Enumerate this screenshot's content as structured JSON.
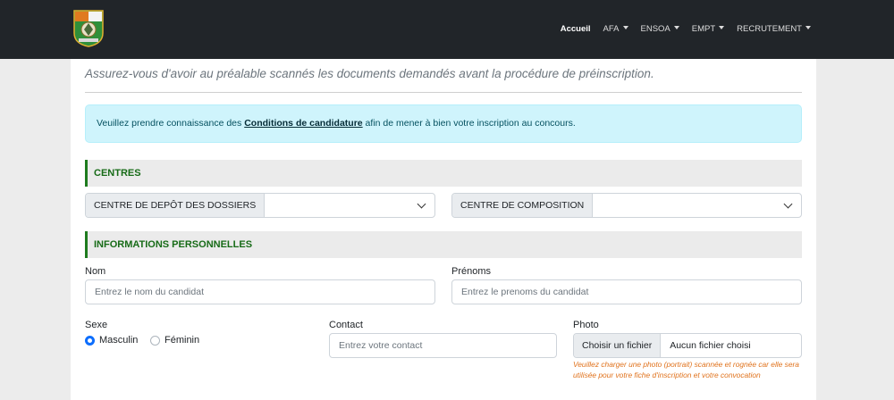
{
  "nav": {
    "logo": "crest-logo",
    "items": [
      {
        "label": "Accueil",
        "dropdown": false,
        "active": true
      },
      {
        "label": "AFA",
        "dropdown": true,
        "active": false
      },
      {
        "label": "ENSOA",
        "dropdown": true,
        "active": false
      },
      {
        "label": "EMPT",
        "dropdown": true,
        "active": false
      },
      {
        "label": "RECRUTEMENT",
        "dropdown": true,
        "active": false
      }
    ]
  },
  "intro": "Assurez-vous d'avoir au préalable scannés les documents demandés avant la procédure de préinscription.",
  "alert": {
    "before": "Veuillez prendre connaissance des ",
    "link": "Conditions de candidature",
    "after": " afin de mener à bien votre inscription au concours."
  },
  "sections": {
    "centres": "CENTRES",
    "personal": "INFORMATIONS PERSONNELLES"
  },
  "centres": {
    "depot_label": "CENTRE DE DEPÔT DES DOSSIERS",
    "depot_value": "",
    "composition_label": "CENTRE DE COMPOSITION",
    "composition_value": ""
  },
  "form": {
    "nom_label": "Nom",
    "nom_placeholder": "Entrez le nom du candidat",
    "prenoms_label": "Prénoms",
    "prenoms_placeholder": "Entrez le prenoms du candidat",
    "sexe_label": "Sexe",
    "sexe_options": [
      "Masculin",
      "Féminin"
    ],
    "sexe_selected": "Masculin",
    "contact_label": "Contact",
    "contact_placeholder": "Entrez votre contact",
    "photo_label": "Photo",
    "photo_button": "Choisir un fichier",
    "photo_filename": "Aucun fichier choisi",
    "photo_help": "Veuillez charger une photo (portrait) scannée et rognée car elle sera utilisée pour votre fiche d'inscription et votre convocation"
  },
  "colors": {
    "navbar": "#212529",
    "section_accent": "#1e7b1e",
    "alert_bg": "#cff4fc",
    "help_text": "#e0721c",
    "radio_checked": "#0d6efd"
  }
}
